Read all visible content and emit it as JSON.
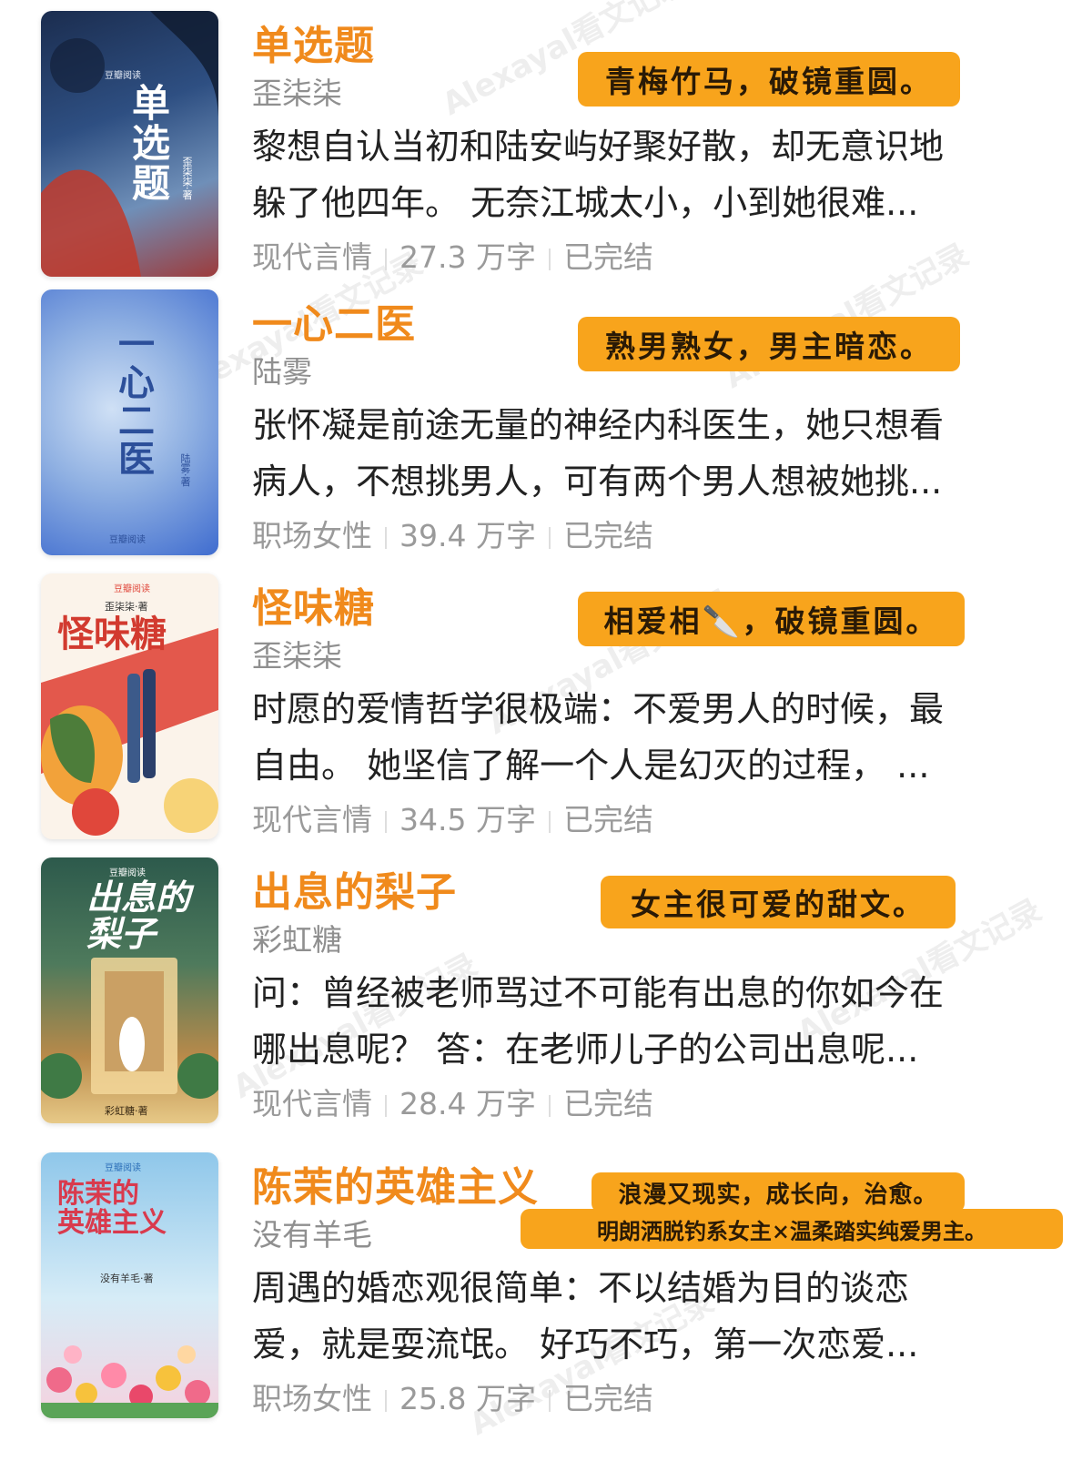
{
  "colors": {
    "title": "#f08a1c",
    "tag_background": "#f8a41c",
    "author": "#8f8f8f",
    "meta": "#9a9a9a"
  },
  "watermark": "Alexayal看文记录",
  "books": [
    {
      "title": "单选题",
      "author": "歪柒柒",
      "tag": "青梅竹马，破镜重圆。",
      "desc_lines": [
        "黎想自认当初和陆安屿好聚好散，却无意识地",
        "躲了他四年。 无奈江城太小，小到她很难..."
      ],
      "category": "现代言情",
      "word_count": "27.3 万字",
      "status": "已完结",
      "cover": {
        "title": "单\n选\n题",
        "author": "歪柒柒·著",
        "brand": "豆瓣阅读"
      }
    },
    {
      "title": "一心二医",
      "author": "陆雾",
      "tag": "熟男熟女，男主暗恋。",
      "desc_lines": [
        "张怀凝是前途无量的神经内科医生，她只想看",
        "病人，不想挑男人，可有两个男人想被她挑..."
      ],
      "category": "职场女性",
      "word_count": "39.4 万字",
      "status": "已完结",
      "cover": {
        "title": "一\n心\n二\n医",
        "author": "陆雾·著",
        "brand": "豆瓣阅读"
      }
    },
    {
      "title": "怪味糖",
      "author": "歪柒柒",
      "tag": "相爱相🔪，破镜重圆。",
      "desc_lines": [
        "时愿的爱情哲学很极端：不爱男人的时候，最",
        "自由。 她坚信了解一个人是幻灭的过程， ..."
      ],
      "category": "现代言情",
      "word_count": "34.5 万字",
      "status": "已完结",
      "cover": {
        "title": "怪味糖",
        "author": "歪柒柒·著",
        "brand": "豆瓣阅读"
      }
    },
    {
      "title": "出息的梨子",
      "author": "彩虹糖",
      "tag": "女主很可爱的甜文。",
      "desc_lines": [
        "问：曾经被老师骂过不可能有出息的你如今在",
        "哪出息呢？ 答：在老师儿子的公司出息呢..."
      ],
      "category": "现代言情",
      "word_count": "28.4 万字",
      "status": "已完结",
      "cover": {
        "title": "出息的\n梨子",
        "author": "彩虹糖·著",
        "brand": "豆瓣阅读"
      }
    },
    {
      "title": "陈茉的英雄主义",
      "author": "没有羊毛",
      "tags": [
        "浪漫又现实，成长向，治愈。",
        "明朗洒脱钓系女主×温柔踏实纯爱男主。"
      ],
      "desc_lines": [
        "周遇的婚恋观很简单：不以结婚为目的谈恋",
        "爱，就是耍流氓。 好巧不巧，第一次恋爱..."
      ],
      "category": "职场女性",
      "word_count": "25.8 万字",
      "status": "已完结",
      "cover": {
        "title": "陈茉的\n英雄主义",
        "author": "没有羊毛·著",
        "brand": "豆瓣阅读"
      }
    }
  ]
}
